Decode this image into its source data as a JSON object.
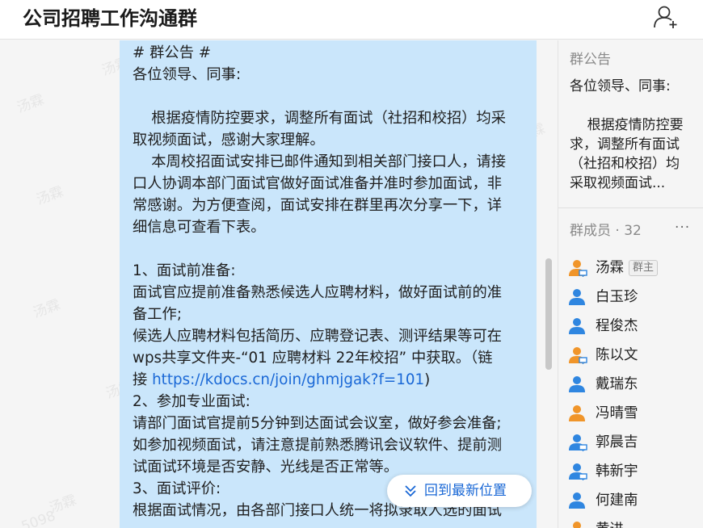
{
  "header": {
    "title": "公司招聘工作沟通群",
    "add_member_icon": "add-member-icon"
  },
  "watermarks": [
    "汤霖",
    "汤霖",
    "汤霖",
    "汤霖",
    "汤霖",
    "5098",
    "汤霖",
    "汤霖"
  ],
  "message": {
    "lines": [
      "# 群公告 #",
      "各位领导、同事:",
      "",
      "    根据疫情防控要求，调整所有面试（社招和校招）均采",
      "取视频面试，感谢大家理解。",
      "    本周校招面试安排已邮件通知到相关部门接口人，请接",
      "口人协调本部门面试官做好面试准备并准时参加面试，非",
      "常感谢。为方便查阅，面试安排在群里再次分享一下，详",
      "细信息可查看下表。",
      "",
      "1、面试前准备:",
      "面试官应提前准备熟悉候选人应聘材料，做好面试前的准",
      "备工作;",
      "候选人应聘材料包括简历、应聘登记表、测评结果等可在",
      "wps共享文件夹-“01 应聘材料 22年校招” 中获取。（链"
    ],
    "link_prefix": "接 ",
    "link_text": "https://kdocs.cn/join/ghmjgak?f=101",
    "link_suffix": ")",
    "lines_after": [
      "2、参加专业面试:",
      "请部门面试官提前5分钟到达面试会议室，做好参会准备;",
      "如参加视频面试，请注意提前熟悉腾讯会议软件、提前测",
      "试面试环境是否安静、光线是否正常等。",
      "3、面试评价:",
      "根据面试情况，由各部门接口人统一将拟录取人选的面试"
    ]
  },
  "jump_button": {
    "label": "回到最新位置",
    "icon": "double-chevron-down-icon"
  },
  "sidebar": {
    "notice_heading": "群公告",
    "notice_body": "各位领导、同事:\n\n    根据疫情防控要求，调整所有面试（社招和校招）均采取视频面试...",
    "members_heading": "群成员 · 32",
    "more_icon": "more-icon",
    "members": [
      {
        "name": "汤霖",
        "badge": "群主",
        "color": "#f0952a",
        "device": "pc"
      },
      {
        "name": "白玉珍",
        "badge": "",
        "color": "#2f86e0",
        "device": ""
      },
      {
        "name": "程俊杰",
        "badge": "",
        "color": "#2f86e0",
        "device": ""
      },
      {
        "name": "陈以文",
        "badge": "",
        "color": "#f0952a",
        "device": "pc"
      },
      {
        "name": "戴瑞东",
        "badge": "",
        "color": "#2f86e0",
        "device": ""
      },
      {
        "name": "冯晴雪",
        "badge": "",
        "color": "#f0952a",
        "device": ""
      },
      {
        "name": "郭晨吉",
        "badge": "",
        "color": "#2f86e0",
        "device": "pc"
      },
      {
        "name": "韩新宇",
        "badge": "",
        "color": "#2f86e0",
        "device": "pc"
      },
      {
        "name": "何建南",
        "badge": "",
        "color": "#2f86e0",
        "device": ""
      },
      {
        "name": "黄进",
        "badge": "",
        "color": "#f0952a",
        "device": ""
      }
    ]
  }
}
